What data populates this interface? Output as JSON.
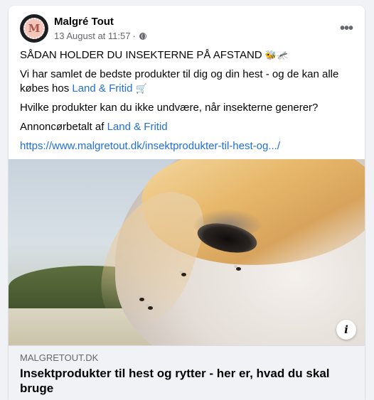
{
  "post": {
    "page_name": "Malgré Tout",
    "avatar_letter": "M",
    "date": "13 August at 11:57",
    "dot": "·",
    "more_icon": "more-horizontal-icon",
    "headline": "SÅDAN HOLDER DU INSEKTERNE PÅ AFSTAND",
    "headline_emoji": "🐝🦟",
    "line2_text": "Vi har samlet de bedste produkter til dig og din hest - og de kan alle købes hos",
    "line2_link": "Land & Fritid",
    "line2_emoji": "🛒",
    "question": "Hvilke produkter kan du ikke undvære, når insekterne generer?",
    "sponsored_prefix": "Annoncørbetalt af",
    "sponsored_link": "Land & Fritid",
    "url": "https://www.malgretout.dk/insektprodukter-til-hest-og.../"
  },
  "link_preview": {
    "domain": "MALGRETOUT.DK",
    "title": "Insektprodukter til hest og rytter - her er, hvad du skal bruge",
    "info_label": "i"
  },
  "colors": {
    "link": "#216fdb",
    "meta": "#65676b",
    "background": "#f0f2f5"
  }
}
